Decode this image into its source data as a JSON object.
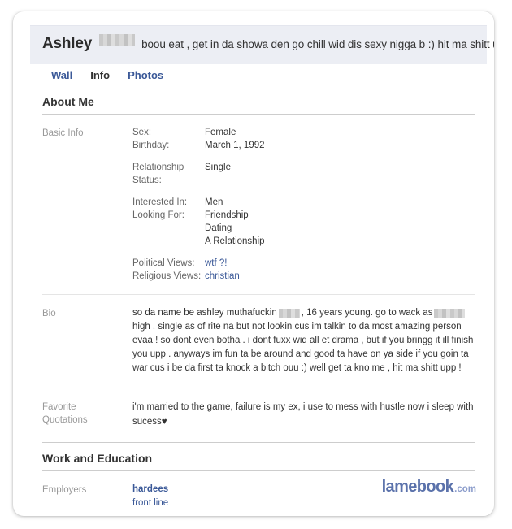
{
  "header": {
    "profile_name": "Ashley",
    "redacted_surname": "[redacted]",
    "status_text": "boou eat , get in da showa den go chill wid dis sexy nigga b :) hit ma shitt uppp !"
  },
  "tabs": [
    {
      "label": "Wall",
      "active": false
    },
    {
      "label": "Info",
      "active": true
    },
    {
      "label": "Photos",
      "active": false
    }
  ],
  "sections": {
    "about_me": {
      "title": "About Me",
      "basic_info": {
        "label": "Basic Info",
        "groups": [
          {
            "fields": [
              {
                "key": "Sex:",
                "value": "Female",
                "link": false
              },
              {
                "key": "Birthday:",
                "value": "March 1, 1992",
                "link": false
              }
            ],
            "extra": []
          },
          {
            "fields": [
              {
                "key": "Relationship Status:",
                "value": "Single",
                "link": false
              }
            ],
            "extra": []
          },
          {
            "fields": [
              {
                "key": "Interested In:",
                "value": "Men",
                "link": false
              },
              {
                "key": "Looking For:",
                "value": "Friendship",
                "link": false
              }
            ],
            "extra": [
              "Dating",
              "A Relationship"
            ]
          },
          {
            "fields": [
              {
                "key": "Political Views:",
                "value": "wtf ?!",
                "link": true
              },
              {
                "key": "Religious Views:",
                "value": "christian",
                "link": true
              }
            ],
            "extra": []
          }
        ]
      },
      "bio": {
        "label": "Bio",
        "text_part_1": "so da name be ashley muthafuckin",
        "text_part_2": ", 16 years young. go to wack as",
        "text_part_3": "high . single as of rite na but not lookin cus im talkin to da most amazing person evaa ! so dont even botha . i dont fuxx wid all et drama , but if you bringg it ill finish you upp . anyways im fun ta be around and good ta have on ya side if you goin ta war cus i be da first ta knock a bitch ouu :) well get ta kno me , hit ma shitt upp !"
      },
      "favorite_quotations": {
        "label_line_1": "Favorite",
        "label_line_2": "Quotations",
        "text": "i'm married to the game, failure is my ex, i use to mess with hustle now i sleep with sucess♥"
      }
    },
    "work_and_education": {
      "title": "Work and Education",
      "employers": {
        "label": "Employers",
        "name": "hardees",
        "position": "front line"
      }
    }
  },
  "watermark": {
    "main": "lamebook",
    "tld": ".com"
  },
  "colors": {
    "facebook_blue": "#3b5998",
    "header_bg": "#eceef4",
    "text": "#333333",
    "muted_label": "#999999",
    "watermark": "#5b72ab"
  }
}
